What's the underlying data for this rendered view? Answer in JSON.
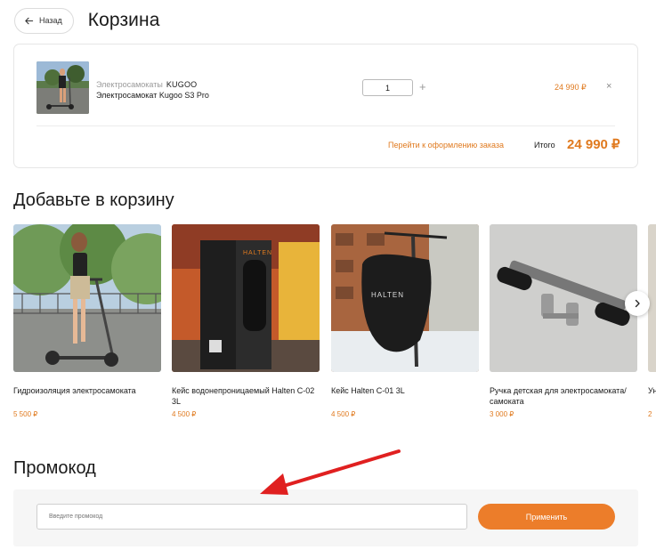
{
  "header": {
    "back_label": "Назад",
    "title": "Корзина"
  },
  "cart": {
    "item": {
      "category": "Электросамокаты",
      "brand": "KUGOO",
      "name": "Электросамокат Kugoo S3 Pro",
      "quantity": "1",
      "plus": "+",
      "price": "24 990 ₽",
      "remove": "×"
    },
    "checkout_link": "Перейти к оформлению заказа",
    "total_label": "Итого",
    "total_value": "24 990 ₽"
  },
  "recommendations": {
    "title": "Добавьте в корзину",
    "products": [
      {
        "name": "Гидроизоляция электросамоката",
        "price": "5 500 ₽"
      },
      {
        "name": "Кейс водонепроницаемый Halten C-02 3L",
        "price": "4 500 ₽"
      },
      {
        "name": "Кейс Halten C-01 3L",
        "price": "4 500 ₽"
      },
      {
        "name": "Ручка детская для электросамоката/самоката",
        "price": "3 000 ₽"
      },
      {
        "name": "Ун",
        "price": "2"
      }
    ],
    "brand_print": "HALTEN"
  },
  "promo": {
    "title": "Промокод",
    "placeholder": "Введите промокод",
    "apply_label": "Применить"
  },
  "colors": {
    "accent": "#ec7d2a",
    "price": "#e07a1f",
    "annotation_arrow": "#e02020"
  }
}
